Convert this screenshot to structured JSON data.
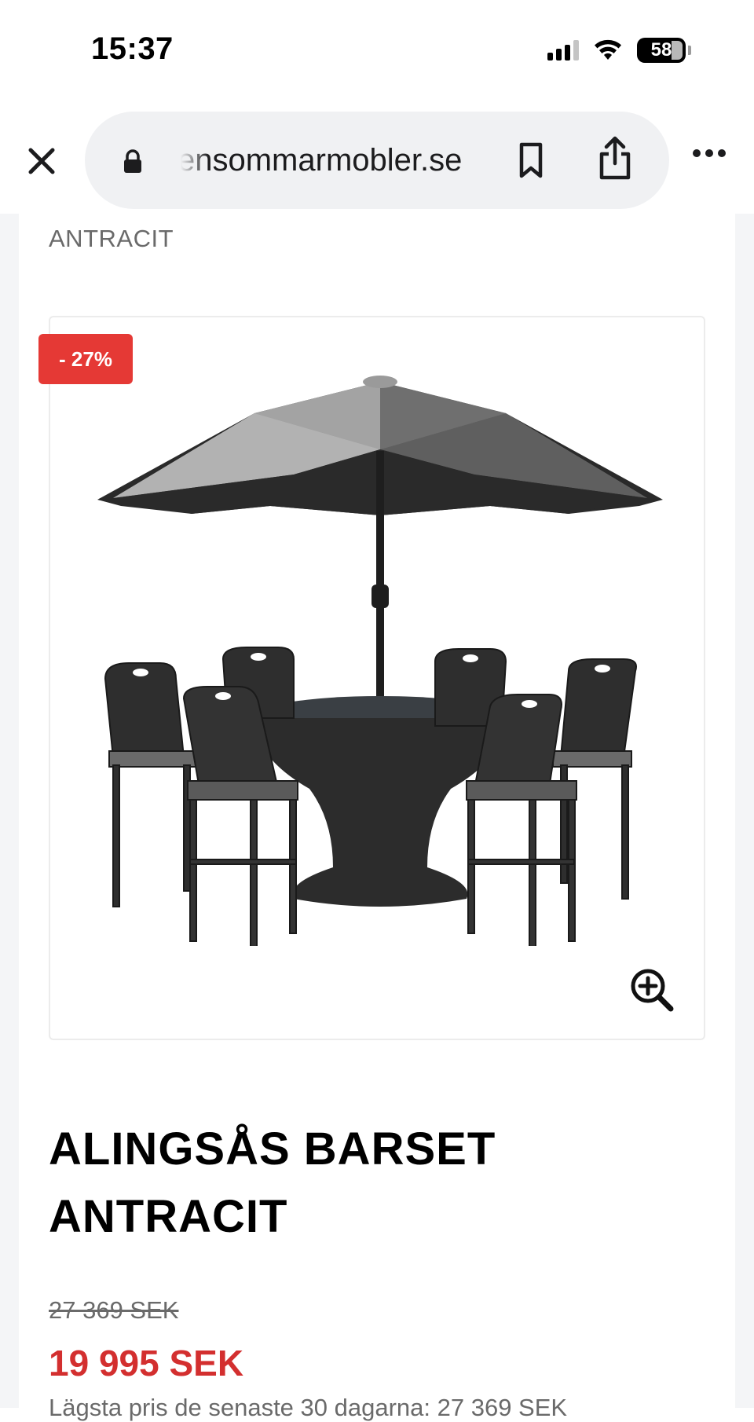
{
  "status_bar": {
    "time": "15:37",
    "battery": "58"
  },
  "browser": {
    "url": "ensommarmobler.se",
    "close_icon": "close-icon",
    "lock_icon": "lock-icon",
    "bookmark_icon": "bookmark-icon",
    "share_icon": "share-icon",
    "more_icon": "more-icon"
  },
  "product": {
    "variant_label": "ANTRACIT",
    "discount": "- 27%",
    "title_line1": "ALINGSÅS BARSET",
    "title_line2": "ANTRACIT",
    "old_price": "27 369 SEK",
    "new_price": "19 995 SEK",
    "lowest_price_note": "Lägsta pris de senaste 30 dagarna: 27 369 SEK",
    "zoom_icon": "zoom-in-icon",
    "colors": {
      "badge": "#e53935",
      "sale_price": "#d32f2f"
    }
  }
}
